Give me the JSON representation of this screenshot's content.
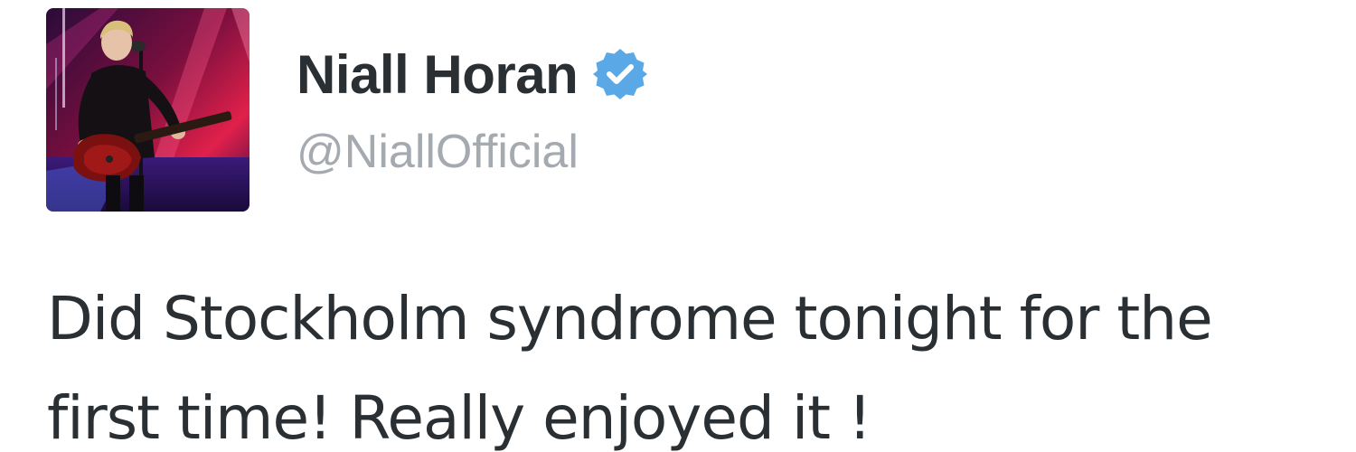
{
  "tweet": {
    "author": {
      "display_name": "Niall Horan",
      "handle": "@NiallOfficial",
      "verified": true,
      "avatar": "avatar-photo-performer-with-guitar"
    },
    "text": "Did Stockholm syndrome tonight for the first time! Really enjoyed it !"
  },
  "icons": {
    "verified": "verified-badge-icon"
  },
  "colors": {
    "name": "#292f33",
    "handle": "#a4aab0",
    "text": "#292f33",
    "verified_badge": "#5aa9e6",
    "background": "#ffffff"
  }
}
